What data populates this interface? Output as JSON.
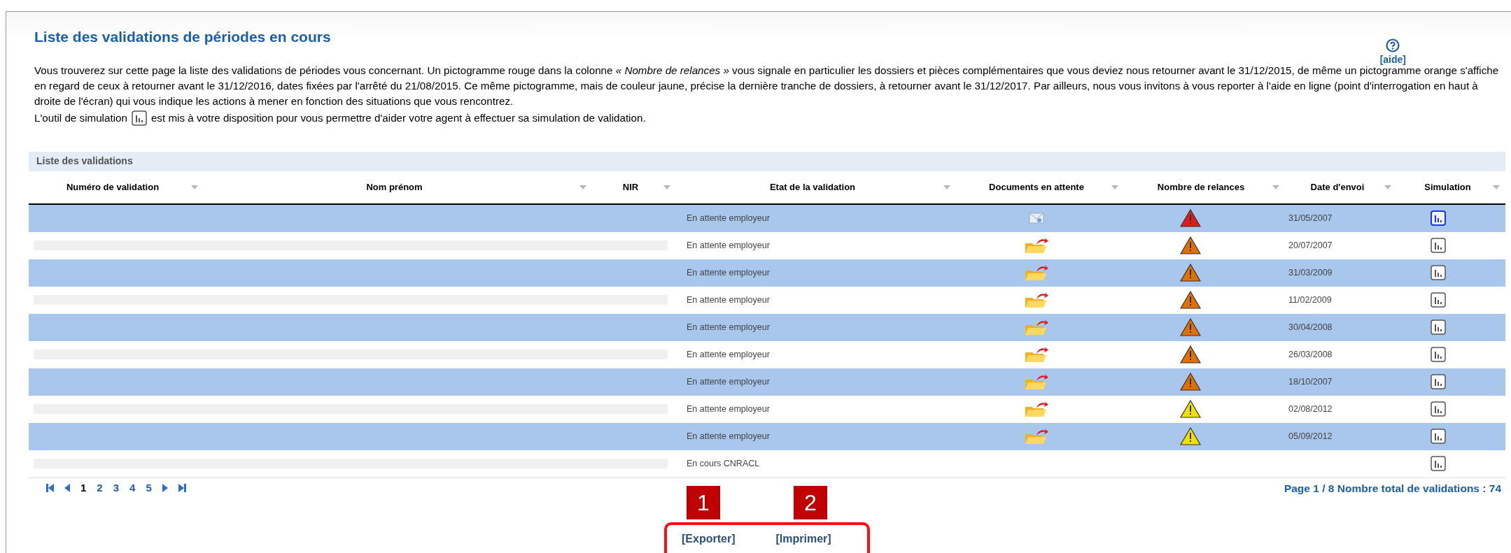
{
  "title": "Liste des validations de périodes en cours",
  "help": {
    "label": "[aide]"
  },
  "intro": "Vous trouverez sur cette page la liste des validations de périodes vous concernant. Un pictogramme rouge dans la colonne *« Nombre de relances »* vous signale en particulier les dossiers et pièces complémentaires que vous deviez nous retourner avant le 31/12/2015, de même un pictogramme orange s'affiche en regard de ceux à retourner avant le 31/12/2016, dates fixées par l'arrêté du 21/08/2015. Ce même pictogramme, mais de couleur jaune, précise la dernière tranche de dossiers, à retourner avant le 31/12/2017. Par ailleurs, nous vous invitons à vous reporter à l'aide en ligne (point d'interrogation en haut à droite de l'écran) qui vous indique les actions à mener en fonction des situations que vous rencontrez.",
  "simulation_note": {
    "before": "L'outil de simulation",
    "after": "est mis à votre disposition pour vous permettre d'aider votre agent à effectuer sa simulation de validation."
  },
  "table": {
    "title": "Liste des validations",
    "columns": [
      "Numéro de validation",
      "Nom prénom",
      "NIR",
      "Etat de la validation",
      "Documents en attente",
      "Nombre de relances",
      "Date d'envoi",
      "Simulation"
    ],
    "rows": [
      {
        "selected": true,
        "status": "En attente employeur",
        "document": {
          "kind": "mail"
        },
        "warning": {
          "color": "#e01b1b"
        },
        "date": "31/05/2007",
        "simulation_active": true
      },
      {
        "selected": false,
        "status": "En attente employeur",
        "document": {
          "kind": "folder"
        },
        "warning": {
          "color": "#e07000"
        },
        "date": "20/07/2007",
        "simulation_active": false
      },
      {
        "selected": true,
        "status": "En attente employeur",
        "document": {
          "kind": "folder"
        },
        "warning": {
          "color": "#e07000"
        },
        "date": "31/03/2009",
        "simulation_active": false
      },
      {
        "selected": false,
        "status": "En attente employeur",
        "document": {
          "kind": "folder"
        },
        "warning": {
          "color": "#e07000"
        },
        "date": "11/02/2009",
        "simulation_active": false
      },
      {
        "selected": true,
        "status": "En attente employeur",
        "document": {
          "kind": "folder"
        },
        "warning": {
          "color": "#e07000"
        },
        "date": "30/04/2008",
        "simulation_active": false
      },
      {
        "selected": false,
        "status": "En attente employeur",
        "document": {
          "kind": "folder"
        },
        "warning": {
          "color": "#e07000"
        },
        "date": "26/03/2008",
        "simulation_active": false
      },
      {
        "selected": true,
        "status": "En attente employeur",
        "document": {
          "kind": "folder"
        },
        "warning": {
          "color": "#e07000"
        },
        "date": "18/10/2007",
        "simulation_active": false
      },
      {
        "selected": false,
        "status": "En attente employeur",
        "document": {
          "kind": "folder"
        },
        "warning": {
          "color": "#f0e000"
        },
        "date": "02/08/2012",
        "simulation_active": false
      },
      {
        "selected": true,
        "status": "En attente employeur",
        "document": {
          "kind": "folder"
        },
        "warning": {
          "color": "#f0e000"
        },
        "date": "05/09/2012",
        "simulation_active": false
      },
      {
        "selected": false,
        "status": "En cours CNRACL",
        "simulation_active": false
      }
    ]
  },
  "pagination": {
    "pages": [
      {
        "label": "1",
        "selected": true
      },
      {
        "label": "2",
        "selected": false
      },
      {
        "label": "3",
        "selected": false
      },
      {
        "label": "4",
        "selected": false
      },
      {
        "label": "5",
        "selected": false
      }
    ],
    "info": "Page 1 / 8 Nombre total de validations : 74"
  },
  "actions": [
    "[Exporter]",
    "[Imprimer]"
  ],
  "callouts": [
    "1",
    "2"
  ]
}
